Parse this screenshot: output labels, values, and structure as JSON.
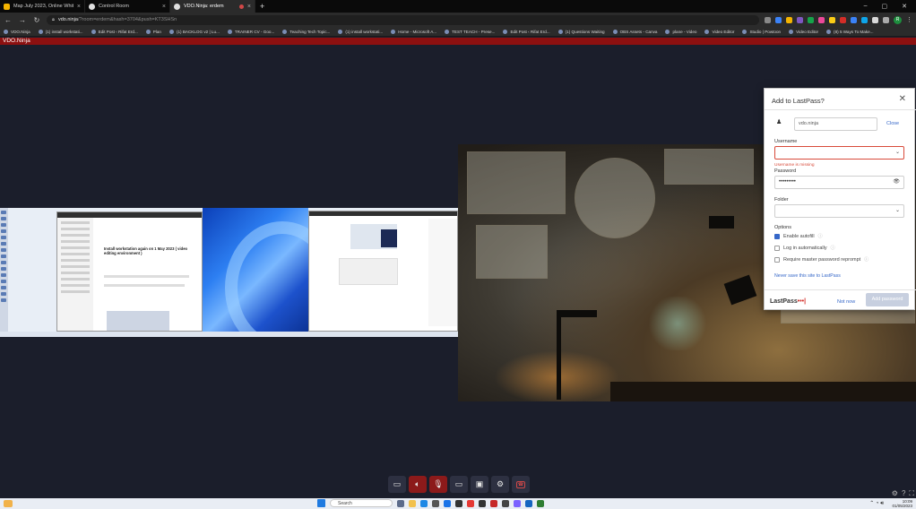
{
  "browser": {
    "tabs": [
      {
        "title": "Map July 2023, Online Whitebo...",
        "active": false
      },
      {
        "title": "Control Room",
        "active": false
      },
      {
        "title": "VDO.Ninja: erdem",
        "active": true
      }
    ],
    "url_host": "vdo.ninja",
    "url_rest": "/?room=erdem&hash=3704&push=KT3SHSn",
    "bookmarks": [
      "VDO.Ninja",
      "(1) install workstati...",
      "Edit Post ‹ Rifat Erd...",
      "Plan",
      "(1) BACKLOG v2 | Lu...",
      "TRAINER CV - Goo...",
      "Teaching Tech Topic...",
      "(1) install workstati...",
      "Home - Microsoft A...",
      "TEST TEACH - Prese...",
      "Edit Post ‹ Rifat Erd...",
      "(1) Questions Waiting",
      "OBS Assets - Canva",
      "plane - Video",
      "Video Editor",
      "Studio | Powtoon",
      "Video Editor",
      "(8) 5 Ways To Make..."
    ]
  },
  "page": {
    "app_label": "VDO.Ninja",
    "share_window_title": "Install workstation again on 1 May 2023 ( video editing environment )",
    "controls": [
      {
        "name": "chat-button",
        "icon": "chat-icon",
        "state": "normal"
      },
      {
        "name": "speaker-button",
        "icon": "speaker-muted-icon",
        "state": "off"
      },
      {
        "name": "mic-button",
        "icon": "mic-muted-icon",
        "state": "off"
      },
      {
        "name": "camera-button",
        "icon": "camera-icon",
        "state": "normal"
      },
      {
        "name": "screenshare-button",
        "icon": "screen-icon",
        "state": "normal"
      },
      {
        "name": "settings-button",
        "icon": "gear-icon",
        "state": "normal"
      },
      {
        "name": "hangup-button",
        "icon": "hangup-icon",
        "state": "normal"
      }
    ]
  },
  "lastpass": {
    "title": "Add to LastPass?",
    "site": "vdo.ninja",
    "close_label": "Close",
    "username_label": "Username",
    "username_value": "",
    "username_error": "Username is missing",
    "password_label": "Password",
    "password_value": "•••••••••",
    "folder_label": "Folder",
    "folder_value": "",
    "options_label": "Options",
    "options": [
      {
        "label": "Enable autofill",
        "checked": true
      },
      {
        "label": "Log in automatically",
        "checked": false
      },
      {
        "label": "Require master password reprompt",
        "checked": false
      }
    ],
    "never_save": "Never save this site to LastPass",
    "brand": "LastPass",
    "brand_dots": "•••|",
    "not_now": "Not now",
    "add_password": "Add password"
  },
  "taskbar": {
    "search_placeholder": "Search",
    "time": "10:09",
    "date": "01/05/2023"
  },
  "colors": {
    "accent_red": "#8c1010",
    "lastpass_blue": "#3567c8",
    "error_red": "#d84a3a"
  }
}
